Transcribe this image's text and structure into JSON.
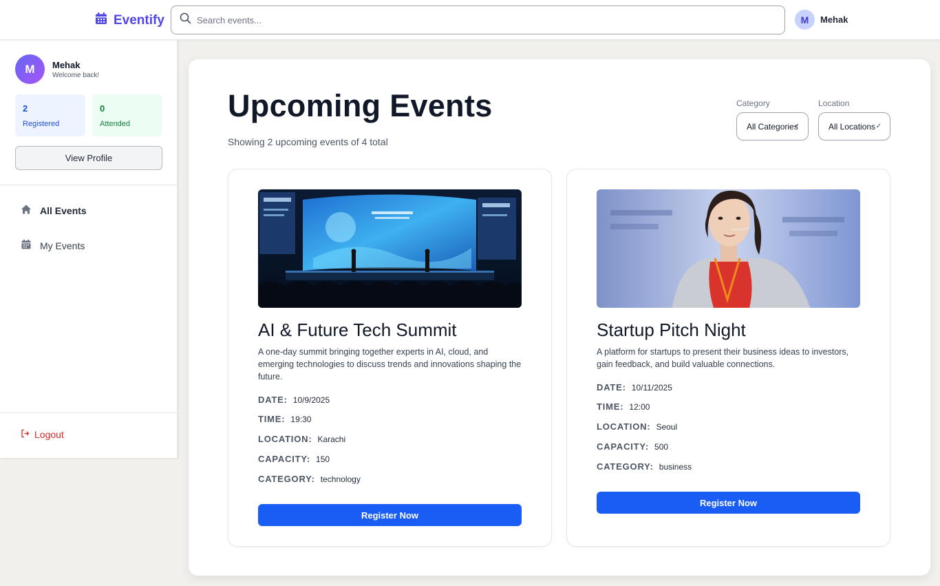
{
  "header": {
    "brand": "Eventify",
    "search_placeholder": "Search events...",
    "user_initial": "M",
    "user_name": "Mehak"
  },
  "sidebar": {
    "profile": {
      "initial": "M",
      "name": "Mehak",
      "subtitle": "Welcome back!"
    },
    "stats": [
      {
        "value": "2",
        "label": "Registered"
      },
      {
        "value": "0",
        "label": "Attended"
      }
    ],
    "view_profile_label": "View Profile",
    "nav": [
      {
        "label": "All Events",
        "icon": "home-icon",
        "active": true
      },
      {
        "label": "My Events",
        "icon": "calendar-icon",
        "active": false
      }
    ],
    "logout_label": "Logout"
  },
  "main": {
    "title": "Upcoming Events",
    "subtitle": "Showing 2 upcoming events of 4 total",
    "filters": [
      {
        "label": "Category",
        "selected": "All Categories"
      },
      {
        "label": "Location",
        "selected": "All Locations"
      }
    ],
    "meta_labels": {
      "date": "DATE:",
      "time": "TIME:",
      "location": "LOCATION:",
      "capacity": "CAPACITY:",
      "category": "CATEGORY:"
    },
    "events": [
      {
        "title": "AI & Future Tech Summit",
        "description": "A one-day summit bringing together experts in AI, cloud, and emerging technologies to discuss trends and innovations shaping the future.",
        "date": "10/9/2025",
        "time": "19:30",
        "location": "Karachi",
        "capacity": "150",
        "category": "technology",
        "button": "Register Now"
      },
      {
        "title": "Startup Pitch Night",
        "description": "A platform for startups to present their business ideas to investors, gain feedback, and build valuable connections.",
        "date": "10/11/2025",
        "time": "12:00",
        "location": "Seoul",
        "capacity": "500",
        "category": "business",
        "button": "Register Now"
      }
    ]
  },
  "colors": {
    "brand": "#4f46e5",
    "primary_button": "#1a5df5",
    "logout": "#dc2626",
    "registered_bg": "#eef4ff",
    "attended_bg": "#ecfdf3"
  }
}
